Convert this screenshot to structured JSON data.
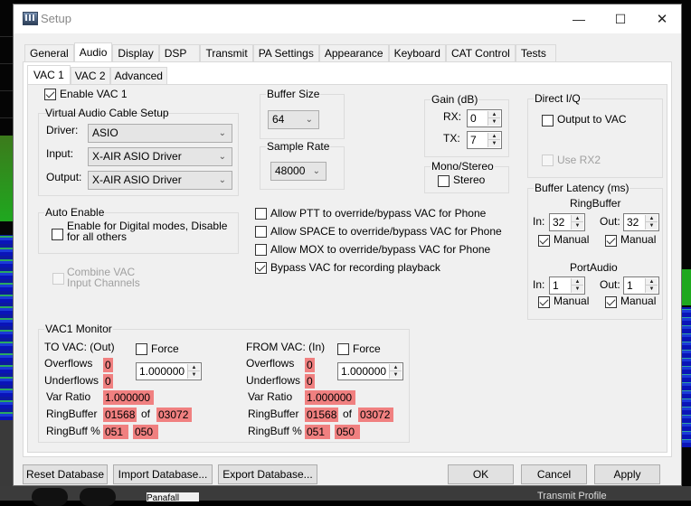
{
  "background": {
    "bottom_labels": [
      "Panafall",
      "Transmit Profile"
    ]
  },
  "window": {
    "title": "Setup",
    "controls": {
      "minimize": "—",
      "maximize": "☐",
      "close": "✕"
    }
  },
  "tabs": [
    {
      "label": "General",
      "active": false
    },
    {
      "label": "Audio",
      "active": true
    },
    {
      "label": "Display",
      "active": false
    },
    {
      "label": "DSP",
      "active": false
    },
    {
      "label": "Transmit",
      "active": false
    },
    {
      "label": "PA Settings",
      "active": false
    },
    {
      "label": "Appearance",
      "active": false
    },
    {
      "label": "Keyboard",
      "active": false
    },
    {
      "label": "CAT Control",
      "active": false
    },
    {
      "label": "Tests",
      "active": false
    }
  ],
  "sub_tabs": [
    {
      "label": "VAC 1",
      "active": true
    },
    {
      "label": "VAC 2",
      "active": false
    },
    {
      "label": "Advanced",
      "active": false
    }
  ],
  "enable_vac": {
    "label": "Enable VAC 1",
    "checked": true
  },
  "vac_setup": {
    "title": "Virtual Audio Cable Setup",
    "driver": {
      "label": "Driver:",
      "value": "ASIO"
    },
    "input": {
      "label": "Input:",
      "value": "X-AIR ASIO Driver"
    },
    "output": {
      "label": "Output:",
      "value": "X-AIR ASIO Driver"
    }
  },
  "buffer_size": {
    "title": "Buffer Size",
    "value": "64"
  },
  "sample_rate": {
    "title": "Sample Rate",
    "value": "48000"
  },
  "gain": {
    "title": "Gain (dB)",
    "rx": {
      "label": "RX:",
      "value": "0"
    },
    "tx": {
      "label": "TX:",
      "value": "7"
    }
  },
  "mono_stereo": {
    "title": "Mono/Stereo",
    "stereo": {
      "label": "Stereo",
      "checked": false
    }
  },
  "direct_iq": {
    "title": "Direct I/Q",
    "output_to_vac": {
      "label": "Output to VAC",
      "checked": false
    },
    "use_rx2": {
      "label": "Use RX2",
      "checked": false,
      "disabled": true
    }
  },
  "buffer_latency": {
    "title": "Buffer Latency (ms)",
    "ringbuffer": {
      "title": "RingBuffer",
      "in": {
        "label": "In:",
        "value": "32"
      },
      "out": {
        "label": "Out:",
        "value": "32"
      },
      "in_manual": {
        "label": "Manual",
        "checked": true
      },
      "out_manual": {
        "label": "Manual",
        "checked": true
      }
    },
    "portaudio": {
      "title": "PortAudio",
      "in": {
        "label": "In:",
        "value": "1"
      },
      "out": {
        "label": "Out:",
        "value": "1"
      },
      "in_manual": {
        "label": "Manual",
        "checked": true
      },
      "out_manual": {
        "label": "Manual",
        "checked": true
      }
    }
  },
  "auto_enable": {
    "title": "Auto Enable",
    "digital": {
      "label_line1": "Enable for Digital modes, Disable",
      "label_line2": "for all others",
      "checked": false
    }
  },
  "combine_vac": {
    "label_line1": "Combine VAC",
    "label_line2": "Input Channels",
    "checked": false,
    "disabled": true
  },
  "options": [
    {
      "label": "Allow PTT to override/bypass VAC for Phone",
      "checked": false
    },
    {
      "label": "Allow SPACE to override/bypass VAC for Phone",
      "checked": false
    },
    {
      "label": "Allow MOX to override/bypass VAC for Phone",
      "checked": false
    },
    {
      "label": "Bypass VAC for recording playback",
      "checked": true
    }
  ],
  "monitor": {
    "title": "VAC1 Monitor",
    "to_vac": {
      "heading": "TO VAC: (Out)",
      "force": {
        "label": "Force",
        "checked": false
      },
      "force_value": "1.000000",
      "overflows_label": "Overflows",
      "overflows": "0",
      "underflows_label": "Underflows",
      "underflows": "0",
      "var_ratio_label": "Var Ratio",
      "var_ratio": "1.000000",
      "ringbuffer_label": "RingBuffer",
      "ringbuffer_used": "01568",
      "of_label": "of",
      "ringbuffer_size": "03072",
      "ringbuff_pct_label": "RingBuff %",
      "ringbuff_pct_a": "051",
      "ringbuff_pct_b": "050"
    },
    "from_vac": {
      "heading": "FROM VAC: (In)",
      "force": {
        "label": "Force",
        "checked": false
      },
      "force_value": "1.000000",
      "overflows_label": "Overflows",
      "overflows": "0",
      "underflows_label": "Underflows",
      "underflows": "0",
      "var_ratio_label": "Var Ratio",
      "var_ratio": "1.000000",
      "ringbuffer_label": "RingBuffer",
      "ringbuffer_used": "01568",
      "of_label": "of",
      "ringbuffer_size": "03072",
      "ringbuff_pct_label": "RingBuff %",
      "ringbuff_pct_a": "051",
      "ringbuff_pct_b": "050"
    }
  },
  "footer": {
    "reset": "Reset Database",
    "import": "Import Database...",
    "export": "Export Database...",
    "ok": "OK",
    "cancel": "Cancel",
    "apply": "Apply"
  },
  "colors": {
    "monitor_value_bg": "#f08080",
    "dialog_bg": "#f0f0f0"
  }
}
